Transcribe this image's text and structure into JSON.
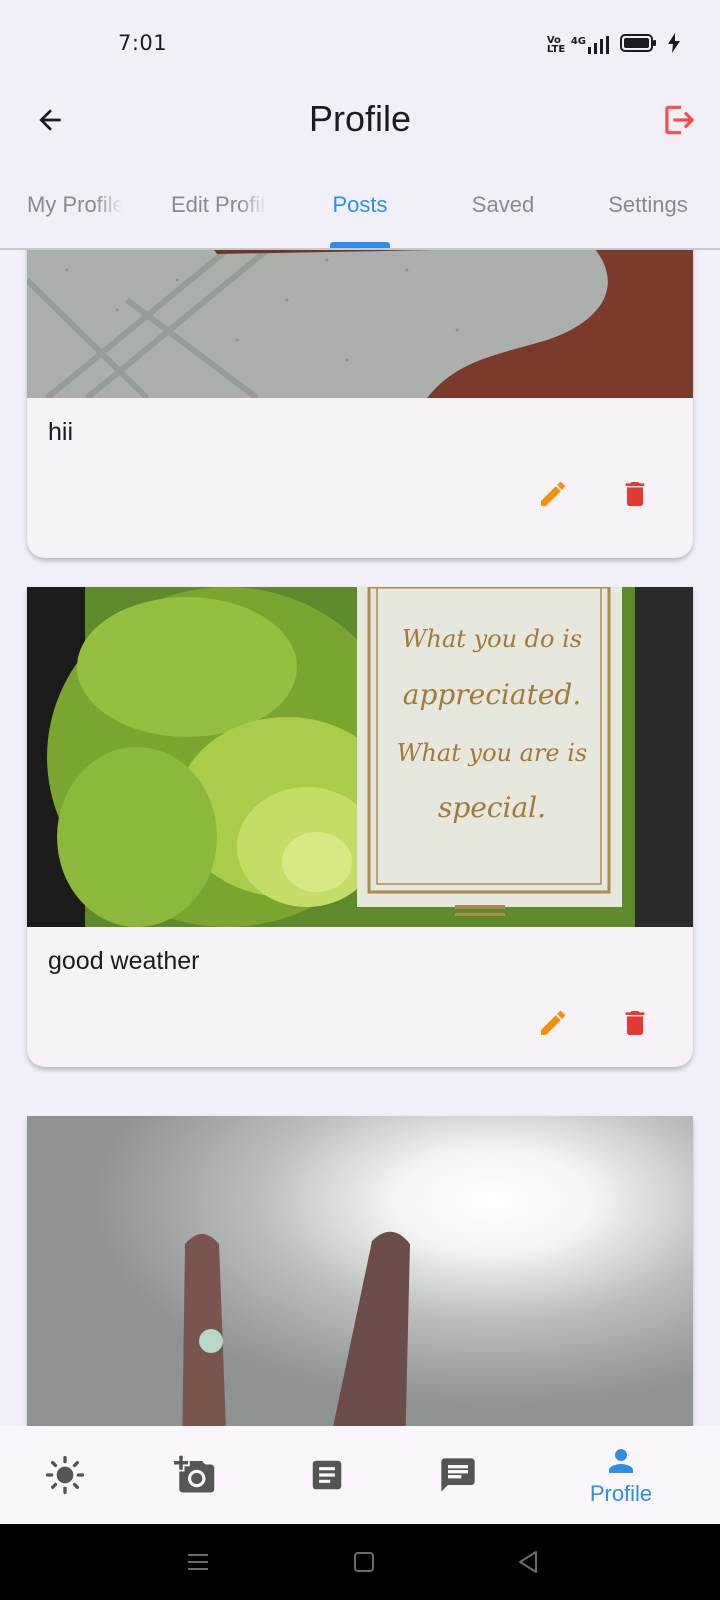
{
  "status": {
    "time": "7:01",
    "network": "4G",
    "volte": "Vo LTE"
  },
  "appbar": {
    "title": "Profile"
  },
  "tabs": [
    {
      "label": "My Profile",
      "active": false
    },
    {
      "label": "Edit Profile",
      "active": false
    },
    {
      "label": "Posts",
      "active": true
    },
    {
      "label": "Saved",
      "active": false
    },
    {
      "label": "Settings",
      "active": false
    }
  ],
  "posts": [
    {
      "caption": "hii",
      "photo": "ceiling tiles and a hand"
    },
    {
      "caption": "good weather",
      "photo": "green succulent card",
      "card_text": [
        "What you do is",
        "appreciated.",
        "What you are is",
        "special."
      ]
    },
    {
      "caption": "",
      "photo": "two fingers against bright light"
    }
  ],
  "bottom_nav": [
    {
      "icon": "sun-icon",
      "label": ""
    },
    {
      "icon": "add-photo-icon",
      "label": ""
    },
    {
      "icon": "article-icon",
      "label": ""
    },
    {
      "icon": "chat-icon",
      "label": ""
    },
    {
      "icon": "person-icon",
      "label": "Profile",
      "active": true
    }
  ],
  "colors": {
    "accent": "#2e8ee6",
    "edit": "#f5900b",
    "delete": "#e53935",
    "logout": "#f05050",
    "background": "#f1eff7"
  }
}
